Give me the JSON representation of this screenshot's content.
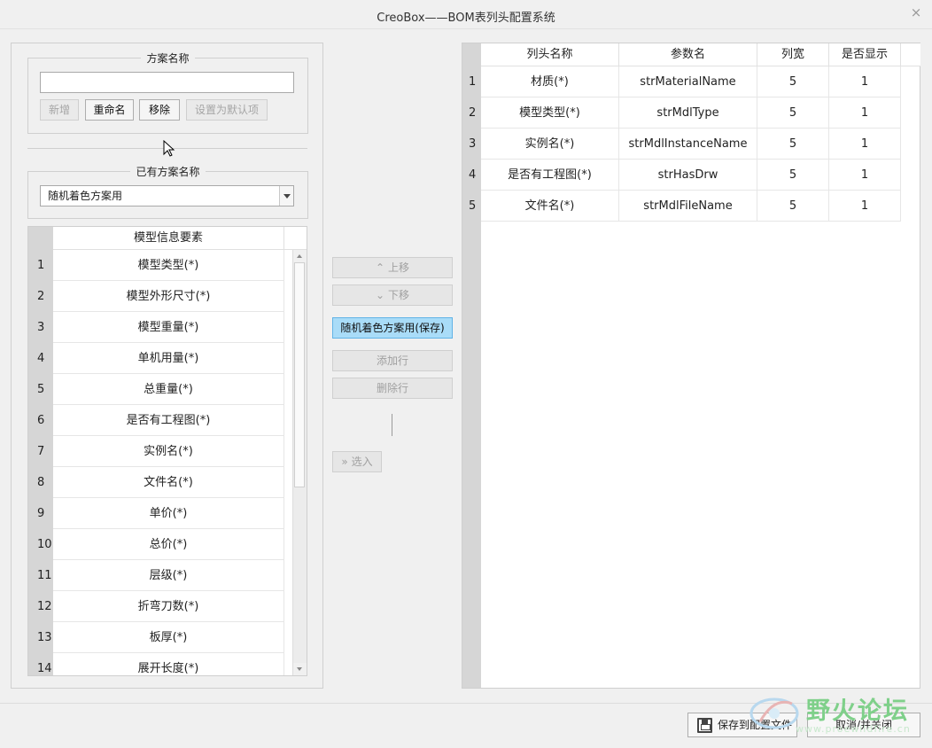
{
  "window": {
    "title": "CreoBox——BOM表列头配置系统",
    "close_glyph": "×"
  },
  "scheme_group": {
    "legend": "方案名称",
    "name_input_value": "",
    "buttons": {
      "add": "新增",
      "rename": "重命名",
      "remove": "移除",
      "set_default": "设置为默认项"
    }
  },
  "existing_group": {
    "legend": "已有方案名称",
    "selected": "随机着色方案用"
  },
  "elements_table": {
    "header": "模型信息要素",
    "rows": [
      {
        "num": "1",
        "label": "模型类型(*)"
      },
      {
        "num": "2",
        "label": "模型外形尺寸(*)"
      },
      {
        "num": "3",
        "label": "模型重量(*)"
      },
      {
        "num": "4",
        "label": "单机用量(*)"
      },
      {
        "num": "5",
        "label": "总重量(*)"
      },
      {
        "num": "6",
        "label": "是否有工程图(*)"
      },
      {
        "num": "7",
        "label": "实例名(*)"
      },
      {
        "num": "8",
        "label": "文件名(*)"
      },
      {
        "num": "9",
        "label": "单价(*)"
      },
      {
        "num": "10",
        "label": "总价(*)"
      },
      {
        "num": "11",
        "label": "层级(*)"
      },
      {
        "num": "12",
        "label": "折弯刀数(*)"
      },
      {
        "num": "13",
        "label": "板厚(*)"
      },
      {
        "num": "14",
        "label": "展开长度(*)"
      }
    ]
  },
  "middle_buttons": {
    "move_up": "上移",
    "move_up_icon": "⌃",
    "move_down": "下移",
    "move_down_icon": "⌄",
    "save_scheme": "随机着色方案用(保存)",
    "add_row": "添加行",
    "delete_row": "删除行",
    "select_in": "选入",
    "select_in_icon": "»"
  },
  "columns_table": {
    "headers": {
      "name": "列头名称",
      "param": "参数名",
      "width": "列宽",
      "show": "是否显示"
    },
    "rows": [
      {
        "num": "1",
        "name": "材质(*)",
        "param": "strMaterialName",
        "width": "5",
        "show": "1"
      },
      {
        "num": "2",
        "name": "模型类型(*)",
        "param": "strMdlType",
        "width": "5",
        "show": "1"
      },
      {
        "num": "3",
        "name": "实例名(*)",
        "param": "strMdlInstanceName",
        "width": "5",
        "show": "1"
      },
      {
        "num": "4",
        "name": "是否有工程图(*)",
        "param": "strHasDrw",
        "width": "5",
        "show": "1"
      },
      {
        "num": "5",
        "name": "文件名(*)",
        "param": "strMdlFileName",
        "width": "5",
        "show": "1"
      }
    ]
  },
  "footer": {
    "save_to_file": "保存到配置文件",
    "cancel_close": "取消/并关闭"
  },
  "watermark": {
    "text": "野火论坛",
    "url": "www.proewildfire.cn"
  }
}
